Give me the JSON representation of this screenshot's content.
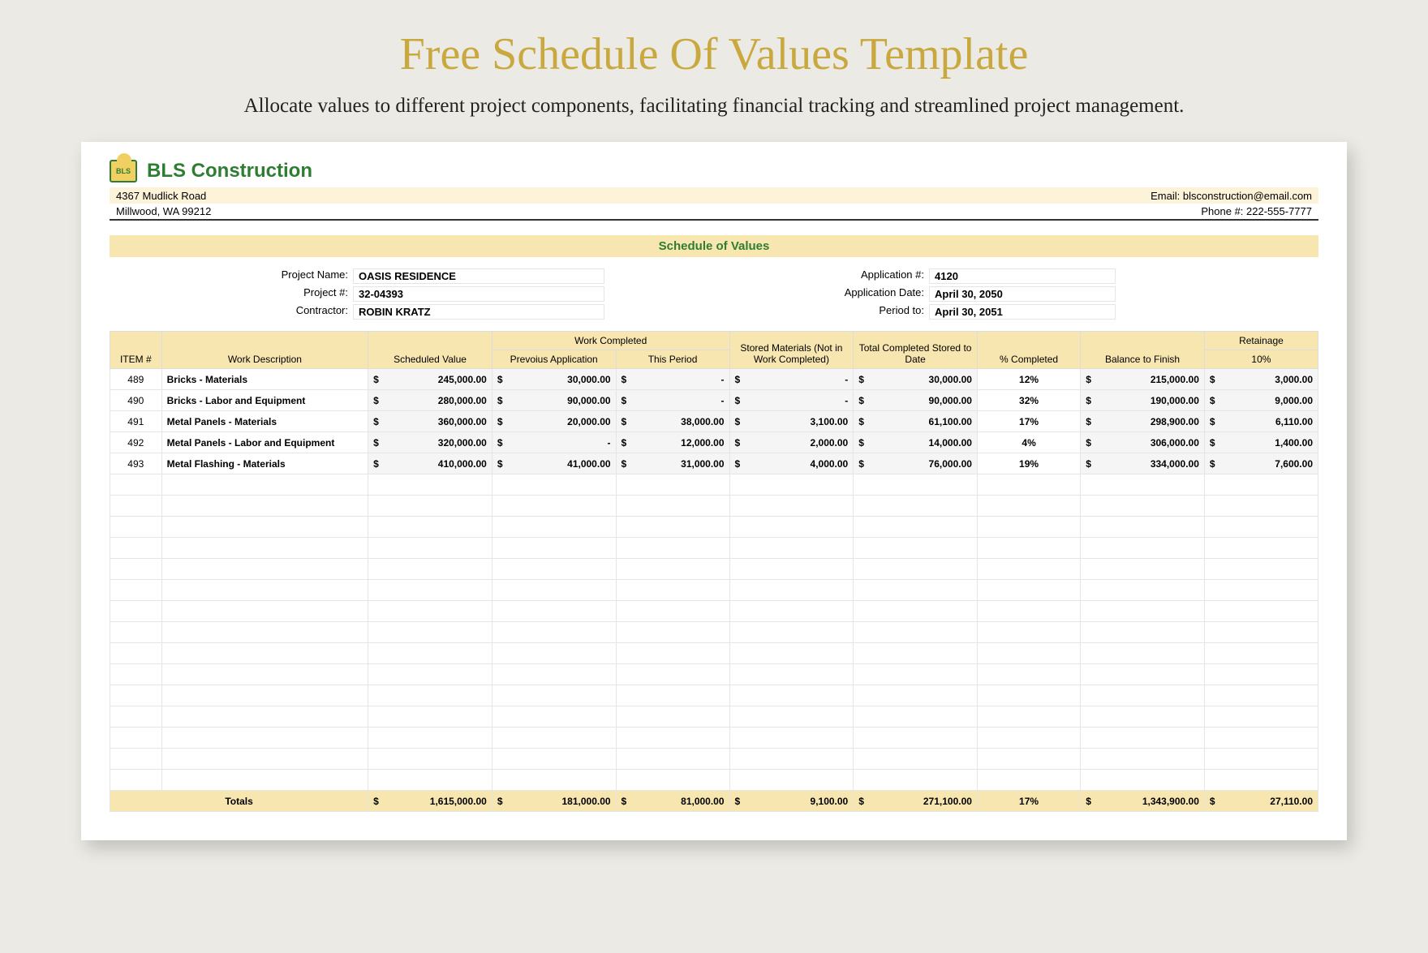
{
  "page": {
    "title": "Free Schedule Of Values Template",
    "subtitle": "Allocate values to different project components, facilitating financial tracking and streamlined project management."
  },
  "company": {
    "name": "BLS Construction",
    "logo_text": "BLS",
    "address1": "4367 Mudlick Road",
    "address2": "Millwood, WA 99212",
    "email_label": "Email: blsconstruction@email.com",
    "phone_label": "Phone #: 222-555-7777"
  },
  "doc_title": "Schedule of Values",
  "meta": {
    "left": [
      {
        "label": "Project Name:",
        "value": "OASIS RESIDENCE"
      },
      {
        "label": "Project #:",
        "value": "32-04393"
      },
      {
        "label": "Contractor:",
        "value": "ROBIN KRATZ"
      }
    ],
    "right": [
      {
        "label": "Application #:",
        "value": "4120"
      },
      {
        "label": "Application Date:",
        "value": "April 30, 2050"
      },
      {
        "label": "Period to:",
        "value": "April 30, 2051"
      }
    ]
  },
  "headers": {
    "item": "ITEM #",
    "desc": "Work Description",
    "sched": "Scheduled Value",
    "work_completed": "Work Completed",
    "prev": "Prevoius Application",
    "this": "This Period",
    "stored": "Stored Materials (Not in Work Completed)",
    "total": "Total Completed Stored to Date",
    "pct": "% Completed",
    "balance": "Balance to Finish",
    "retain": "Retainage",
    "retain_pct": "10%"
  },
  "rows": [
    {
      "item": "489",
      "desc": "Bricks - Materials",
      "sched": "245,000.00",
      "prev": "30,000.00",
      "this": "-",
      "stored": "-",
      "total": "30,000.00",
      "pct": "12%",
      "balance": "215,000.00",
      "retain": "3,000.00"
    },
    {
      "item": "490",
      "desc": "Bricks - Labor and Equipment",
      "sched": "280,000.00",
      "prev": "90,000.00",
      "this": "-",
      "stored": "-",
      "total": "90,000.00",
      "pct": "32%",
      "balance": "190,000.00",
      "retain": "9,000.00"
    },
    {
      "item": "491",
      "desc": "Metal Panels - Materials",
      "sched": "360,000.00",
      "prev": "20,000.00",
      "this": "38,000.00",
      "stored": "3,100.00",
      "total": "61,100.00",
      "pct": "17%",
      "balance": "298,900.00",
      "retain": "6,110.00"
    },
    {
      "item": "492",
      "desc": "Metal Panels - Labor and Equipment",
      "sched": "320,000.00",
      "prev": "-",
      "this": "12,000.00",
      "stored": "2,000.00",
      "total": "14,000.00",
      "pct": "4%",
      "balance": "306,000.00",
      "retain": "1,400.00"
    },
    {
      "item": "493",
      "desc": "Metal Flashing - Materials",
      "sched": "410,000.00",
      "prev": "41,000.00",
      "this": "31,000.00",
      "stored": "4,000.00",
      "total": "76,000.00",
      "pct": "19%",
      "balance": "334,000.00",
      "retain": "7,600.00"
    }
  ],
  "empty_rows": 15,
  "totals": {
    "label": "Totals",
    "sched": "1,615,000.00",
    "prev": "181,000.00",
    "this": "81,000.00",
    "stored": "9,100.00",
    "total": "271,100.00",
    "pct": "17%",
    "balance": "1,343,900.00",
    "retain": "27,110.00"
  },
  "currency": "$"
}
